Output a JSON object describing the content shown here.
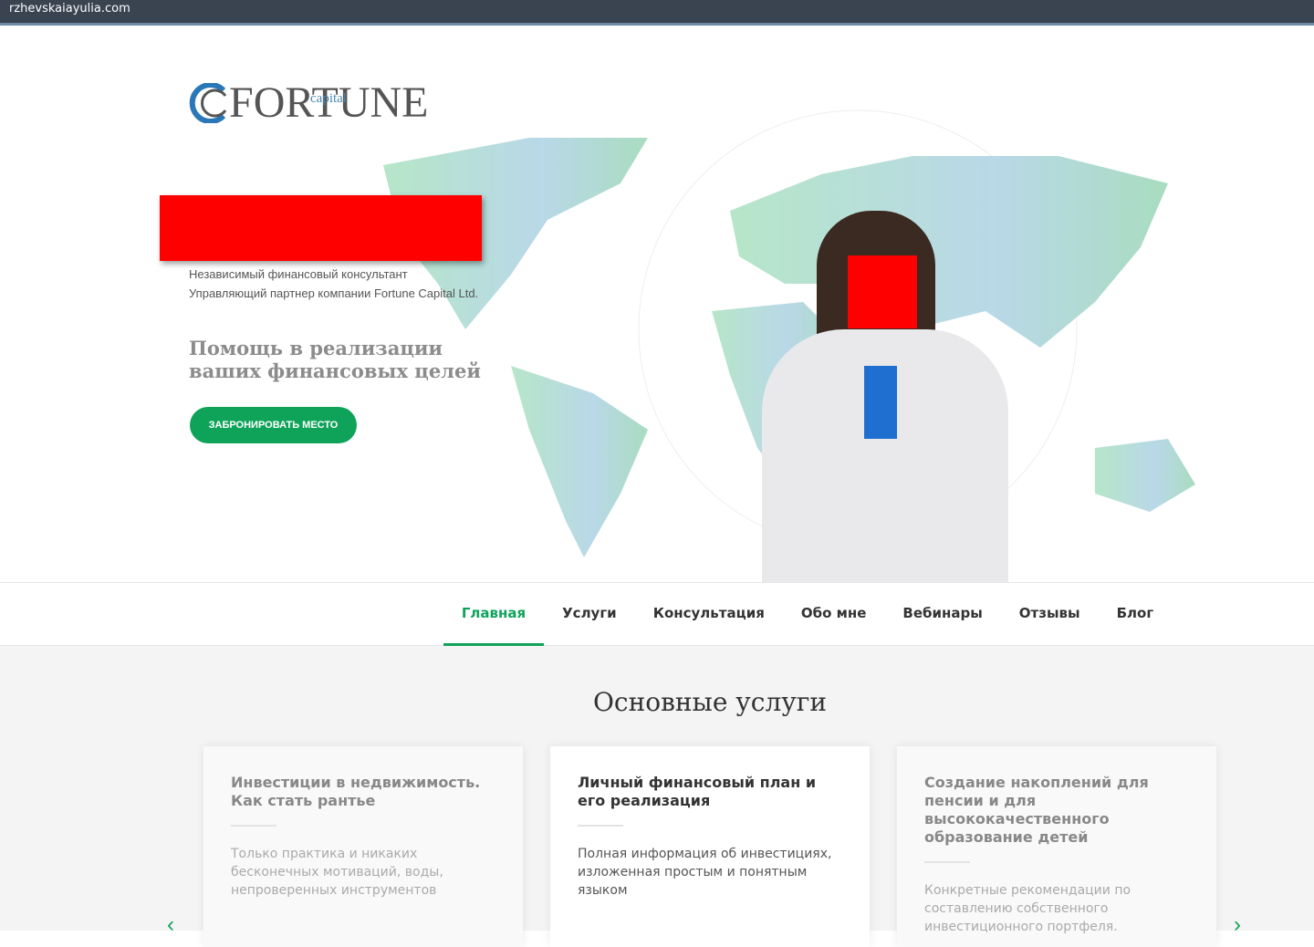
{
  "browser": {
    "url": "rzhevskaiayulia.com"
  },
  "logo": {
    "text": "FORTUNE",
    "sub": "capital"
  },
  "hero": {
    "subtitle1": "Независимый финансовый консультант",
    "subtitle2": "Управляющий партнер компании Fortune Capital Ltd.",
    "tagline": "Помощь в реализации ваших финансовых целей",
    "cta": "ЗАБРОНИРОВАТЬ МЕСТО"
  },
  "nav": [
    "Главная",
    "Услуги",
    "Консультация",
    "Обо мне",
    "Вебинары",
    "Отзывы",
    "Блог"
  ],
  "services": {
    "title": "Основные услуги",
    "cards": [
      {
        "title": "Инвестиции в недвижимость. Как стать рантье",
        "text": "Только практика и никаких бесконечных мотиваций, воды, непроверенных инструментов"
      },
      {
        "title": "Личный финансовый план и его реализация",
        "text": "Полная информация об инвестициях, изложенная простым и понятным языком"
      },
      {
        "title": "Создание накоплений для пенсии и для высококачественного образование детей",
        "text": "Конкретные рекомендации по составлению собственного инвестиционного портфеля."
      }
    ]
  },
  "colors": {
    "accent": "#0fa35a"
  }
}
